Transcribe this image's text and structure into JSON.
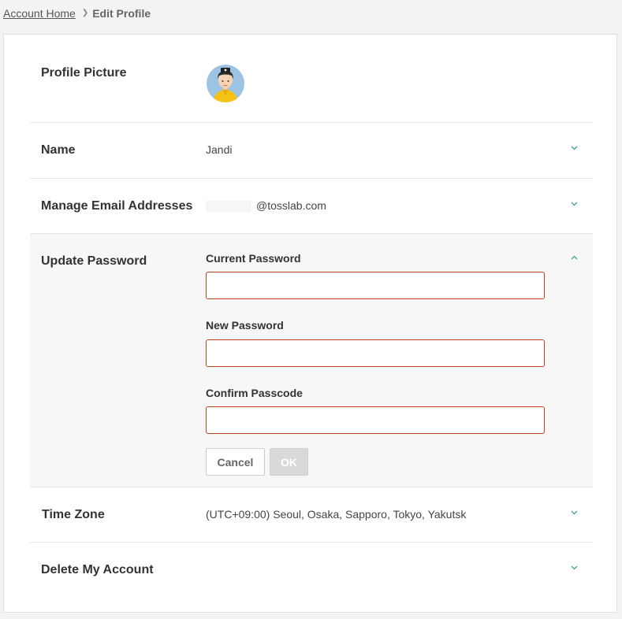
{
  "breadcrumb": {
    "home": "Account Home",
    "current": "Edit Profile"
  },
  "profile_picture": {
    "label": "Profile Picture"
  },
  "name": {
    "label": "Name",
    "value": "Jandi"
  },
  "email": {
    "label": "Manage Email Addresses",
    "value": "@tosslab.com"
  },
  "password": {
    "label": "Update Password",
    "current_label": "Current Password",
    "new_label": "New Password",
    "confirm_label": "Confirm Passcode",
    "current_value": "",
    "new_value": "",
    "confirm_value": "",
    "cancel_label": "Cancel",
    "ok_label": "OK"
  },
  "timezone": {
    "label": "Time Zone",
    "value": "(UTC+09:00) Seoul, Osaka, Sapporo, Tokyo, Yakutsk"
  },
  "delete": {
    "label": "Delete My Account"
  },
  "colors": {
    "accent": "#4aa596",
    "input_border": "#c0431c",
    "expanded_bg": "#f7f7f7"
  },
  "icons": {
    "collapsed": "chevron-down-icon",
    "expanded": "chevron-up-icon"
  }
}
